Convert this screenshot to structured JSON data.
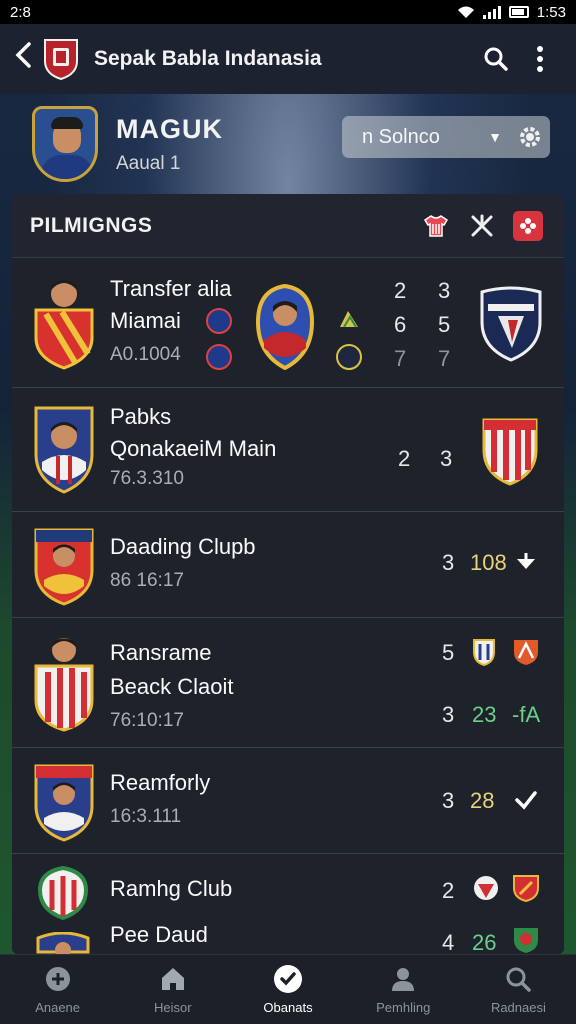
{
  "statusbar": {
    "left": "2:8",
    "time": "1:53"
  },
  "appbar": {
    "title": "Sepak Babla Indanasia"
  },
  "profile": {
    "name": "MAGUK",
    "sub": "Aaual  1",
    "dropdown": "n Solnco"
  },
  "section": {
    "title": "PILMIGNGS"
  },
  "rows": [
    {
      "line1": "Transfer alia",
      "line2": "Miamai",
      "sub": "A0.1004",
      "nums": [
        [
          "2",
          "3"
        ],
        [
          "6",
          "5"
        ],
        [
          "7",
          "7"
        ]
      ]
    },
    {
      "line1": "Pabks",
      "line2": "QonakaeiM Main",
      "sub": "76.3.310",
      "nums": [
        "2",
        "3"
      ]
    },
    {
      "line1": "Daading Clupb",
      "sub": "86 16:17",
      "nums": [
        "3",
        "108"
      ]
    },
    {
      "line1": "Ransrame",
      "line2": "Beack Claoit",
      "sub": "76:10:17",
      "nums": [
        [
          "5"
        ],
        [
          "3",
          "23",
          "-fA"
        ]
      ]
    },
    {
      "line1": "Reamforly",
      "sub": "16:3.111",
      "nums": [
        "3",
        "28"
      ]
    },
    {
      "line1": "Ramhg Club",
      "line2": "Pee Daud",
      "nums": [
        [
          "2"
        ],
        [
          "4",
          "26"
        ]
      ]
    }
  ],
  "nav": [
    {
      "label": "Anaene",
      "icon": "plus-circle-icon"
    },
    {
      "label": "Heisor",
      "icon": "home-icon"
    },
    {
      "label": "Obanats",
      "icon": "check-badge-icon",
      "active": true
    },
    {
      "label": "Pemhling",
      "icon": "user-icon"
    },
    {
      "label": "Radnaesi",
      "icon": "search-icon"
    }
  ],
  "colors": {
    "accent_red": "#d8343f",
    "green": "#6ad08a",
    "yellow": "#e8d27a"
  }
}
